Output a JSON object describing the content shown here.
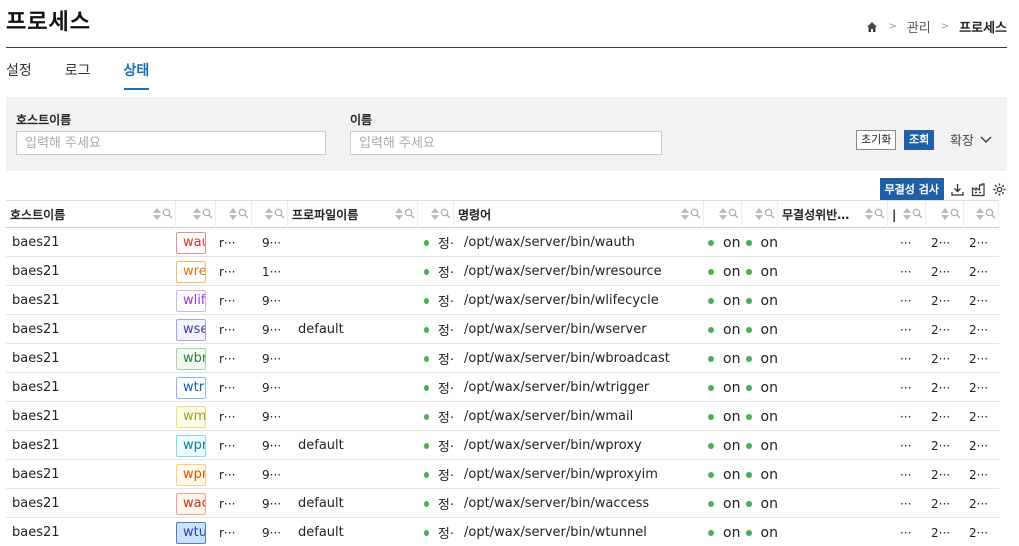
{
  "page": {
    "title": "프로세스"
  },
  "breadcrumb": {
    "level1": "관리",
    "level2": "프로세스",
    "sep": ">"
  },
  "tabs": [
    {
      "label": "설정"
    },
    {
      "label": "로그"
    },
    {
      "label": "상태"
    }
  ],
  "filter": {
    "host_label": "호스트이름",
    "host_placeholder": "입력해 주세요",
    "name_label": "이름",
    "name_placeholder": "입력해 주세요",
    "reset_label": "초기화",
    "search_label": "조회",
    "expand_label": "확장"
  },
  "toolbar": {
    "integrity_label": "무결성 검사"
  },
  "table": {
    "headers": {
      "host": "호스트이름",
      "profile": "프로파일이름",
      "command": "명령어",
      "integrity": "무결성위반…",
      "c9": "|"
    },
    "rows": [
      {
        "host": "baes21",
        "tag": "wau",
        "c3": "r···",
        "c4": "9···",
        "profile": "",
        "status": "정·",
        "command": "/opt/wax/server/bin/wauth",
        "on1": "on",
        "on2": "on",
        "c10": "···",
        "c11": "2···",
        "c12": "2···"
      },
      {
        "host": "baes21",
        "tag": "wre",
        "c3": "r···",
        "c4": "1···",
        "profile": "",
        "status": "정·",
        "command": "/opt/wax/server/bin/wresource",
        "on1": "on",
        "on2": "on",
        "c10": "···",
        "c11": "2···",
        "c12": "2···"
      },
      {
        "host": "baes21",
        "tag": "wlif",
        "c3": "r···",
        "c4": "9···",
        "profile": "",
        "status": "정·",
        "command": "/opt/wax/server/bin/wlifecycle",
        "on1": "on",
        "on2": "on",
        "c10": "···",
        "c11": "2···",
        "c12": "2···"
      },
      {
        "host": "baes21",
        "tag": "wse",
        "c3": "r···",
        "c4": "9···",
        "profile": "default",
        "status": "정·",
        "command": "/opt/wax/server/bin/wserver",
        "on1": "on",
        "on2": "on",
        "c10": "···",
        "c11": "2···",
        "c12": "2···"
      },
      {
        "host": "baes21",
        "tag": "wbr",
        "c3": "r···",
        "c4": "9···",
        "profile": "",
        "status": "정·",
        "command": "/opt/wax/server/bin/wbroadcast",
        "on1": "on",
        "on2": "on",
        "c10": "···",
        "c11": "2···",
        "c12": "2···"
      },
      {
        "host": "baes21",
        "tag": "wtri",
        "c3": "r···",
        "c4": "9···",
        "profile": "",
        "status": "정·",
        "command": "/opt/wax/server/bin/wtrigger",
        "on1": "on",
        "on2": "on",
        "c10": "···",
        "c11": "2···",
        "c12": "2···"
      },
      {
        "host": "baes21",
        "tag": "wm",
        "c3": "r···",
        "c4": "9···",
        "profile": "",
        "status": "정·",
        "command": "/opt/wax/server/bin/wmail",
        "on1": "on",
        "on2": "on",
        "c10": "···",
        "c11": "2···",
        "c12": "2···"
      },
      {
        "host": "baes21",
        "tag": "wpr",
        "c3": "r···",
        "c4": "9···",
        "profile": "default",
        "status": "정·",
        "command": "/opt/wax/server/bin/wproxy",
        "on1": "on",
        "on2": "on",
        "c10": "···",
        "c11": "2···",
        "c12": "2···"
      },
      {
        "host": "baes21",
        "tag": "wpr",
        "c3": "r···",
        "c4": "9···",
        "profile": "",
        "status": "정·",
        "command": "/opt/wax/server/bin/wproxyim",
        "on1": "on",
        "on2": "on",
        "c10": "···",
        "c11": "2···",
        "c12": "2···"
      },
      {
        "host": "baes21",
        "tag": "wac",
        "c3": "r···",
        "c4": "9···",
        "profile": "default",
        "status": "정·",
        "command": "/opt/wax/server/bin/waccess",
        "on1": "on",
        "on2": "on",
        "c10": "···",
        "c11": "2···",
        "c12": "2···"
      },
      {
        "host": "baes21",
        "tag": "wtu",
        "c3": "r···",
        "c4": "9···",
        "profile": "default",
        "status": "정·",
        "command": "/opt/wax/server/bin/wtunnel",
        "on1": "on",
        "on2": "on",
        "c10": "···",
        "c11": "2···",
        "c12": "2···"
      }
    ]
  },
  "colors": {
    "accent": "#1e5fa6",
    "tab_active": "#1a6fb5",
    "status_dot": "#4caf50",
    "tag_colors": [
      {
        "border": "#f28b82",
        "text": "#d93025",
        "bg": "#fff"
      },
      {
        "border": "#f5b971",
        "text": "#e8710a",
        "bg": "#fff"
      },
      {
        "border": "#d7aefb",
        "text": "#9334e6",
        "bg": "#fff"
      },
      {
        "border": "#a8a4f0",
        "text": "#3c3a9e",
        "bg": "#f3f2ff"
      },
      {
        "border": "#a5d6a7",
        "text": "#2e7d32",
        "bg": "#f1f8f1"
      },
      {
        "border": "#8ab4f8",
        "text": "#1a56c4",
        "bg": "#fff"
      },
      {
        "border": "#dce775",
        "text": "#9e9d24",
        "bg": "#fbfce8"
      },
      {
        "border": "#80deea",
        "text": "#00838f",
        "bg": "#effcfd"
      },
      {
        "border": "#ffcc80",
        "text": "#e65100",
        "bg": "#fff8ec"
      },
      {
        "border": "#f6a38f",
        "text": "#c0391b",
        "bg": "#fff4f0"
      },
      {
        "border": "#4a7fd4",
        "text": "#1a4ea0",
        "bg": "#cfe0fb"
      }
    ]
  }
}
